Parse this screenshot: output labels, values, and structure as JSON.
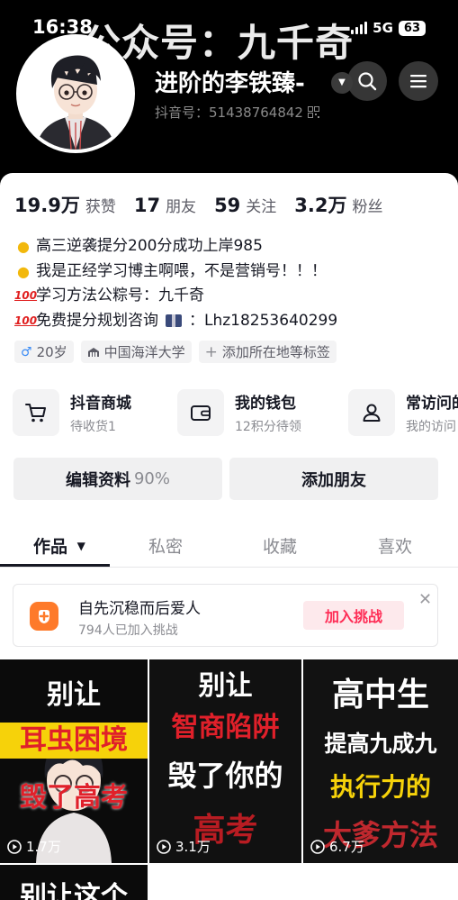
{
  "status_bar": {
    "time": "16:38",
    "network": "5G",
    "battery": "63"
  },
  "watermark": "公众号：九千奇",
  "profile": {
    "nickname": "进阶的李铁臻-",
    "douyin_id": "抖音号：51438764842"
  },
  "stats": [
    {
      "num": "19.9万",
      "label": "获赞"
    },
    {
      "num": "17",
      "label": "朋友"
    },
    {
      "num": "59",
      "label": "关注"
    },
    {
      "num": "3.2万",
      "label": "粉丝"
    }
  ],
  "bio": [
    {
      "icon": "lightbulb",
      "text": "高三逆袭提分200分成功上岸985"
    },
    {
      "icon": "lightbulb",
      "text": "我是正经学习博主啊喂，不是营销号！！！"
    },
    {
      "icon": "hundred-points",
      "text": "学习方法公粽号：九千奇"
    },
    {
      "icon": "hundred-points",
      "text": "免费提分规划咨询",
      "suffix": "：Lhz18253640299"
    }
  ],
  "tags": [
    {
      "icon": "male",
      "text": "20岁"
    },
    {
      "icon": "school",
      "text": "中国海洋大学"
    },
    {
      "icon": "plus",
      "text": "添加所在地等标签"
    }
  ],
  "services": [
    {
      "icon": "cart",
      "title": "抖音商城",
      "sub": "待收货1"
    },
    {
      "icon": "wallet",
      "title": "我的钱包",
      "sub": "12积分待领"
    },
    {
      "icon": "person",
      "title": "常访问的",
      "sub": "我的访问"
    }
  ],
  "actions": {
    "edit": "编辑资料",
    "edit_percent": "90%",
    "add_friend": "添加朋友"
  },
  "tabs": [
    "作品",
    "私密",
    "收藏",
    "喜欢"
  ],
  "challenge": {
    "title": "自先沉稳而后爱人",
    "sub": "794人已加入挑战",
    "button": "加入挑战"
  },
  "videos": [
    {
      "lines": [
        "别让",
        "耳虫困境",
        "毁了高考"
      ],
      "plays": "1.7万"
    },
    {
      "lines": [
        "别让",
        "智商陷阱",
        "毁了你的",
        "高考"
      ],
      "plays": "3.1万"
    },
    {
      "lines": [
        "高中生",
        "提高九成九",
        "执行力的",
        "大爹方法"
      ],
      "plays": "6.7万"
    },
    {
      "lines": [
        "别让这个"
      ]
    }
  ],
  "colors": {
    "accent": "#fe2c55",
    "challenge_icon": "#fe7a2a",
    "highlight_yellow": "#f6d20a",
    "highlight_red": "#e0202a"
  }
}
